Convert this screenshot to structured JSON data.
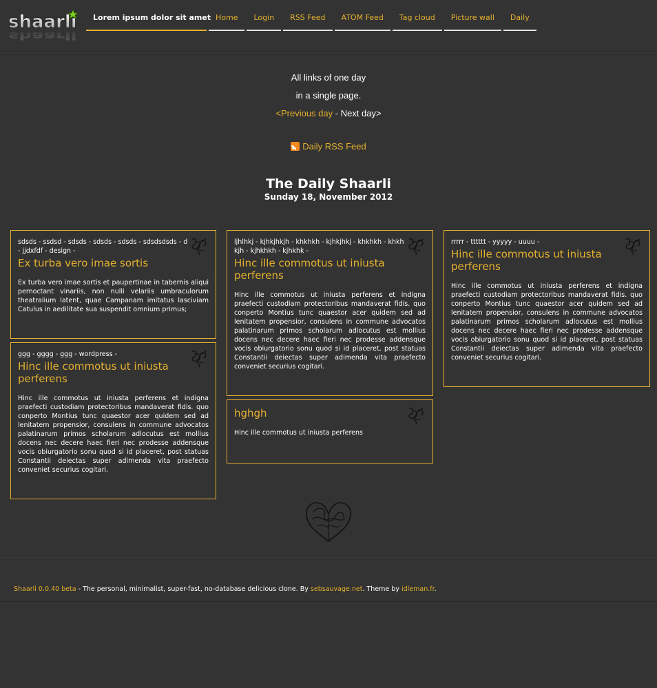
{
  "header": {
    "logo_text": "shaarli",
    "title": "Lorem ipsum dolor sit amet",
    "nav": [
      "Home",
      "Login",
      "RSS Feed",
      "ATOM Feed",
      "Tag cloud",
      "Picture wall",
      "Daily"
    ]
  },
  "intro": {
    "line1": "All links of one day",
    "line2": "in a single page.",
    "previous": "<Previous day",
    "separator": " - ",
    "next": "Next day>"
  },
  "rss": {
    "label": "Daily RSS Feed"
  },
  "daily": {
    "title": "The Daily Shaarli",
    "date": "Sunday 18, November 2012"
  },
  "cards": [
    {
      "tags": "sdsds - ssdsd - sdsds - sdsds - sdsds - sdsdsdsds - d - jjdxfdf - design -",
      "title": "Ex turba vero imae sortis",
      "desc": "Ex turba vero imae sortis et paupertinae in tabernis aliqui pernoctant vinariis, non nulli velariis umbraculorum theatralium latent, quae Campanam imitatus lasciviam Catulus in aedilitate sua suspendit omnium primus;"
    },
    {
      "tags": "ggg - gggg - ggg - wordpress -",
      "title": "Hinc ille commotus ut iniusta perferens",
      "desc": "Hinc ille commotus ut iniusta perferens et indigna praefecti custodiam protectoribus mandaverat fidis. quo conperto Montius tunc quaestor acer quidem sed ad lenitatem propensior, consulens in commune advocatos palatinarum primos scholarum adlocutus est mollius docens nec decere haec fieri nec prodesse addensque vocis obiurgatorio sonu quod si id placeret, post statuas Constantii deiectas super adimenda vita praefecto conveniet securius cogitari."
    },
    {
      "tags": "ljhlhkj - kjhkjhkjh - khkhkh - kjhkjhkj - khkhkh - khkhkjh - kjhkhkh - kjhkhk -",
      "title": "Hinc ille commotus ut iniusta perferens",
      "desc": "Hinc ille commotus ut iniusta perferens et indigna praefecti custodiam protectoribus mandaverat fidis. quo conperto Montius tunc quaestor acer quidem sed ad lenitatem propensior, consulens in commune advocatos palatinarum primos scholarum adlocutus est mollius docens nec decere haec fieri nec prodesse addensque vocis obiurgatorio sonu quod si id placeret, post statuas Constantii deiectas super adimenda vita praefecto conveniet securius cogitari."
    },
    {
      "tags": "",
      "title": "hghgh",
      "desc": "Hinc ille commotus ut iniusta perferens"
    },
    {
      "tags": "rrrrr - tttttt - yyyyy - uuuu -",
      "title": "Hinc ille commotus ut iniusta perferens",
      "desc": "Hinc ille commotus ut iniusta perferens et indigna praefecti custodiam protectoribus mandaverat fidis. quo conperto Montius tunc quaestor acer quidem sed ad lenitatem propensior, consulens in commune advocatos palatinarum primos scholarum adlocutus est mollius docens nec decere haec fieri nec prodesse addensque vocis obiurgatorio sonu quod si id placeret, post statuas Constantii deiectas super adimenda vita praefecto conveniet securius cogitari."
    }
  ],
  "footer": {
    "app": "Shaarli 0.0.40 beta",
    "text1": " - The personal, minimalist, super-fast, no-database delicious clone. By ",
    "author": "sebsauvage.net",
    "text2": ". Theme by ",
    "theme_author": "idleman.fr",
    "text3": "."
  },
  "colors": {
    "accent": "#e5b12f",
    "background": "#333333",
    "text": "#ffffff"
  },
  "icons": [
    "shaarli-logo-icon",
    "rss-icon",
    "flourish-icon",
    "heart-ornament-icon"
  ]
}
